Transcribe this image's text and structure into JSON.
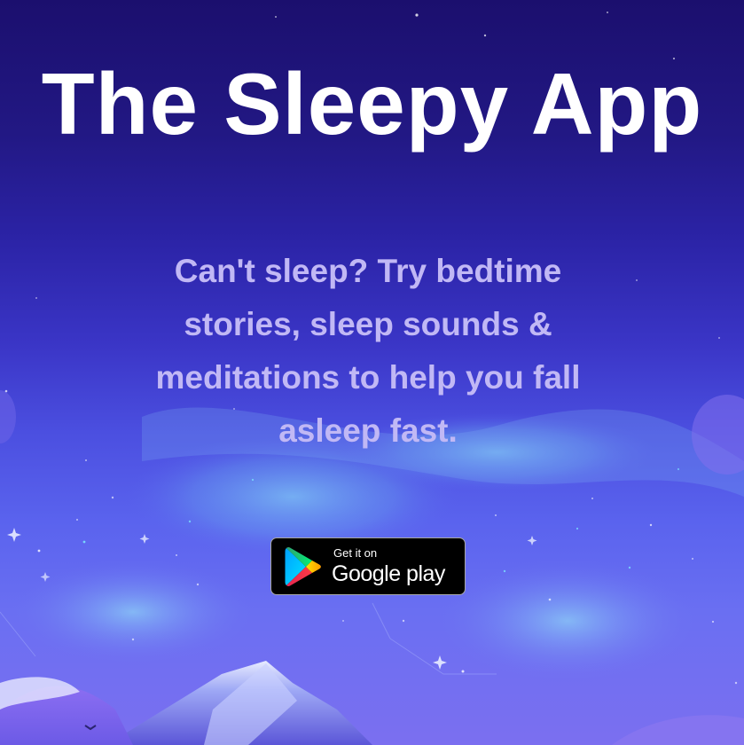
{
  "hero": {
    "title": "The Sleepy App",
    "tagline": "Can't sleep? Try bedtime stories, sleep sounds & meditations to help you fall asleep fast."
  },
  "store_badge": {
    "small_text": "Get it on",
    "large_text": "Google play",
    "icon": "google-play-icon"
  },
  "colors": {
    "title": "#ffffff",
    "tagline": "#c1b8f5",
    "badge_background": "#000000",
    "sky_top": "#1b0f6e",
    "sky_bottom": "#7b6ff0"
  }
}
